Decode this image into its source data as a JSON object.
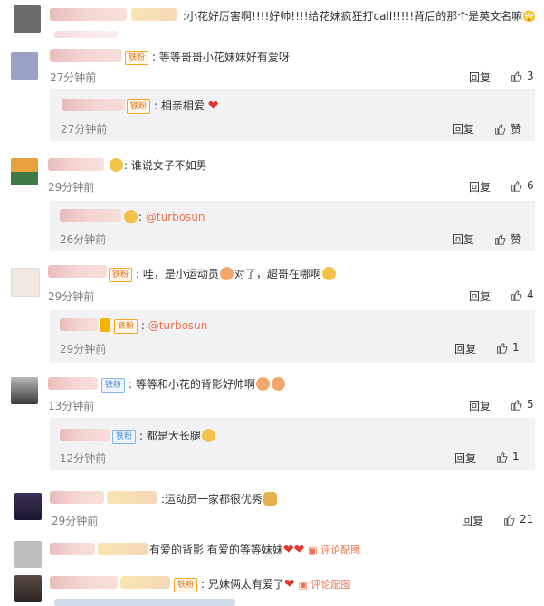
{
  "comments": [
    {
      "text": "小花好厉害啊!!!!好帅!!!!给花妹疯狂打call!!!!!背后的那个是英文名嘛🙄"
    },
    {
      "badge": "铁粉",
      "text": "等等哥哥小花妹妹好有爱呀",
      "time": "27分钟前",
      "reply": "回复",
      "likes": "3"
    },
    {
      "badge": "铁粉",
      "text": "相亲相爱",
      "time": "27分钟前",
      "reply": "回复",
      "likes": "赞"
    },
    {
      "text": "谁说女子不如男",
      "time": "29分钟前",
      "reply": "回复",
      "likes": "6"
    },
    {
      "text": "@turbosun",
      "time": "26分钟前",
      "reply": "回复",
      "likes": "赞"
    },
    {
      "badge": "铁粉",
      "text": "哇，是小运动员",
      "text2": "对了，超哥在哪啊",
      "time": "29分钟前",
      "reply": "回复",
      "likes": "4"
    },
    {
      "badge": "铁粉",
      "text": "@turbosun",
      "time": "29分钟前",
      "reply": "回复",
      "likes": "1"
    },
    {
      "badge": "铁粉",
      "text": "等等和小花的背影好帅啊",
      "time": "13分钟前",
      "reply": "回复",
      "likes": "5"
    },
    {
      "badge": "铁粉",
      "text": "都是大长腿",
      "time": "12分钟前",
      "reply": "回复",
      "likes": "1"
    },
    {
      "text": "运动员一家都很优秀",
      "time": "29分钟前",
      "reply": "回复",
      "likes": "21"
    },
    {
      "text": "有爱的背影 有爱的等等妹妹",
      "picbtn": "评论配图"
    },
    {
      "badge": "铁粉",
      "text": "兄妹俩太有爱了",
      "picbtn": "评论配图"
    }
  ]
}
